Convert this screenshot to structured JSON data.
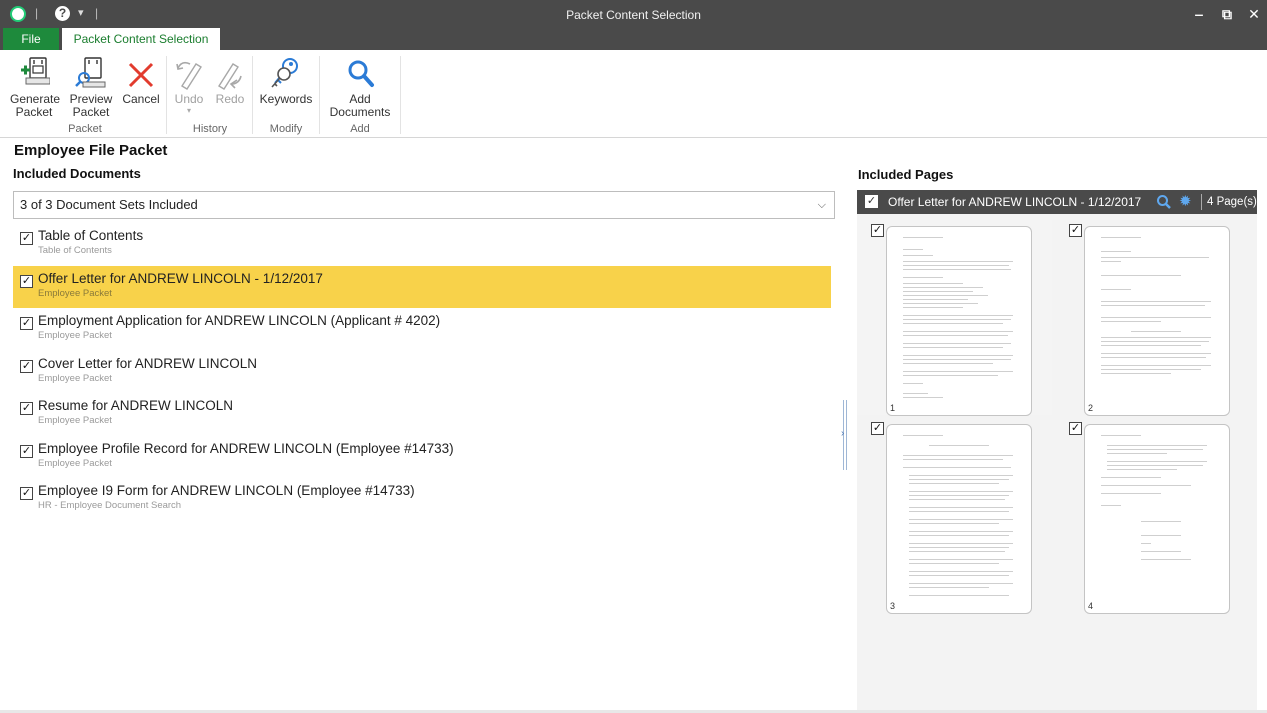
{
  "window": {
    "title": "Packet Content Selection",
    "minimize": "‒",
    "restore": "⧉",
    "close": "✕"
  },
  "ribbon": {
    "tabs": [
      {
        "label": "File"
      },
      {
        "label": "Packet Content Selection"
      }
    ],
    "buttons": {
      "generate": "Generate\nPacket",
      "preview": "Preview\nPacket",
      "cancel": "Cancel",
      "undo": "Undo",
      "redo": "Redo",
      "keywords": "Keywords",
      "add_documents": "Add\nDocuments"
    },
    "groups": {
      "packet": "Packet",
      "history": "History",
      "modify": "Modify",
      "add": "Add"
    }
  },
  "left": {
    "title": "Employee File Packet",
    "subtitle": "Included Documents",
    "selector": "3 of 3 Document Sets Included",
    "documents": [
      {
        "name": "Table of Contents",
        "sub": "Table of Contents",
        "checked": true,
        "selected": false
      },
      {
        "name": "Offer Letter for ANDREW LINCOLN - 1/12/2017",
        "sub": "Employee Packet",
        "checked": true,
        "selected": true
      },
      {
        "name": "Employment Application for ANDREW LINCOLN (Applicant # 4202)",
        "sub": "Employee Packet",
        "checked": true,
        "selected": false
      },
      {
        "name": "Cover Letter for ANDREW LINCOLN",
        "sub": "Employee Packet",
        "checked": true,
        "selected": false
      },
      {
        "name": "Resume for ANDREW LINCOLN",
        "sub": "Employee Packet",
        "checked": true,
        "selected": false
      },
      {
        "name": "Employee Profile Record for ANDREW LINCOLN (Employee #14733)",
        "sub": "Employee Packet",
        "checked": true,
        "selected": false
      },
      {
        "name": "Employee I9 Form for ANDREW LINCOLN (Employee #14733)",
        "sub": "HR - Employee Document Search",
        "checked": true,
        "selected": false
      }
    ]
  },
  "right": {
    "title": "Included Pages",
    "header": "Offer Letter for ANDREW LINCOLN - 1/12/2017",
    "page_count": "4 Page(s)",
    "pages": [
      {
        "number": "1",
        "checked": true
      },
      {
        "number": "2",
        "checked": true
      },
      {
        "number": "3",
        "checked": true
      },
      {
        "number": "4",
        "checked": true
      }
    ]
  },
  "colors": {
    "accent_green": "#1e8a3c",
    "selection_yellow": "#f8d24a",
    "titlebar_gray": "#4a4a4a",
    "icon_blue": "#2b7bd6",
    "cancel_red": "#e23b2e"
  }
}
